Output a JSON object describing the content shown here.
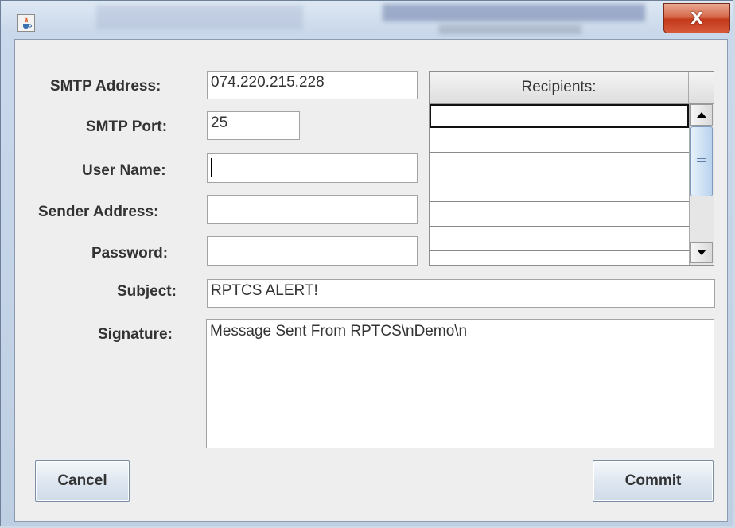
{
  "window": {
    "app_icon": "java-cup-icon",
    "close_label": "X"
  },
  "form": {
    "smtp_address_label": "SMTP Address:",
    "smtp_address_value": "074.220.215.228",
    "smtp_port_label": "SMTP Port:",
    "smtp_port_value": "25",
    "user_name_label": "User Name:",
    "user_name_value": "",
    "sender_address_label": "Sender Address:",
    "sender_address_value": "",
    "password_label": "Password:",
    "password_value": "",
    "subject_label": "Subject:",
    "subject_value": "RPTCS ALERT!",
    "signature_label": "Signature:",
    "signature_value": "Message Sent From RPTCS\\nDemo\\n"
  },
  "recipients": {
    "header": "Recipients:",
    "rows": [
      "",
      "",
      "",
      "",
      "",
      ""
    ]
  },
  "buttons": {
    "cancel_label": "Cancel",
    "commit_label": "Commit"
  },
  "colors": {
    "close_button": "#c4391b",
    "window_bg": "#eeeeee"
  }
}
